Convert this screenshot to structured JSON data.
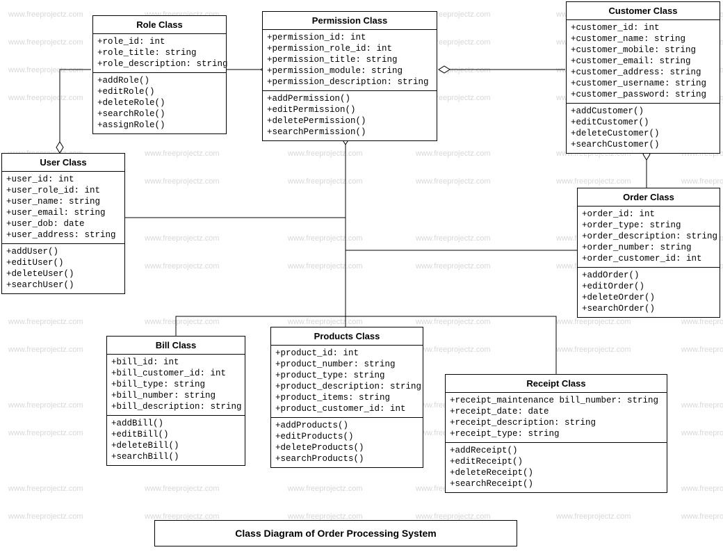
{
  "watermark": "www.freeprojectz.com",
  "caption": "Class Diagram of Order Processing System",
  "classes": {
    "role": {
      "name": "Role Class",
      "attrs": [
        "+role_id: int",
        "+role_title: string",
        "+role_description: string"
      ],
      "ops": [
        "+addRole()",
        "+editRole()",
        "+deleteRole()",
        "+searchRole()",
        "+assignRole()"
      ]
    },
    "permission": {
      "name": "Permission Class",
      "attrs": [
        "+permission_id: int",
        "+permission_role_id: int",
        "+permission_title: string",
        "+permission_module: string",
        "+permission_description: string"
      ],
      "ops": [
        "+addPermission()",
        "+editPermission()",
        "+deletePermission()",
        "+searchPermission()"
      ]
    },
    "customer": {
      "name": "Customer Class",
      "attrs": [
        "+customer_id: int",
        "+customer_name: string",
        "+customer_mobile: string",
        "+customer_email: string",
        "+customer_address: string",
        "+customer_username: string",
        "+customer_password: string"
      ],
      "ops": [
        "+addCustomer()",
        "+editCustomer()",
        "+deleteCustomer()",
        "+searchCustomer()"
      ]
    },
    "user": {
      "name": "User Class",
      "attrs": [
        "+user_id: int",
        "+user_role_id: int",
        "+user_name: string",
        "+user_email: string",
        "+user_dob: date",
        "+user_address: string"
      ],
      "ops": [
        "+addUser()",
        "+editUser()",
        "+deleteUser()",
        "+searchUser()"
      ]
    },
    "order": {
      "name": "Order Class",
      "attrs": [
        "+order_id: int",
        "+order_type: string",
        "+order_description: string",
        "+order_number: string",
        "+order_customer_id: int"
      ],
      "ops": [
        "+addOrder()",
        "+editOrder()",
        "+deleteOrder()",
        "+searchOrder()"
      ]
    },
    "bill": {
      "name": "Bill Class",
      "attrs": [
        "+bill_id: int",
        "+bill_customer_id: int",
        "+bill_type: string",
        "+bill_number: string",
        "+bill_description: string"
      ],
      "ops": [
        "+addBill()",
        "+editBill()",
        "+deleteBill()",
        "+searchBill()"
      ]
    },
    "products": {
      "name": "Products  Class",
      "attrs": [
        "+product_id: int",
        "+product_number: string",
        "+product_type: string",
        "+product_description: string",
        "+product_items: string",
        "+product_customer_id: int"
      ],
      "ops": [
        "+addProducts()",
        "+editProducts()",
        "+deleteProducts()",
        "+searchProducts()"
      ]
    },
    "receipt": {
      "name": "Receipt Class",
      "attrs": [
        "+receipt_maintenance bill_number: string",
        "+receipt_date: date",
        "+receipt_description: string",
        "+receipt_type: string"
      ],
      "ops": [
        "+addReceipt()",
        "+editReceipt()",
        "+deleteReceipt()",
        "+searchReceipt()"
      ]
    }
  }
}
